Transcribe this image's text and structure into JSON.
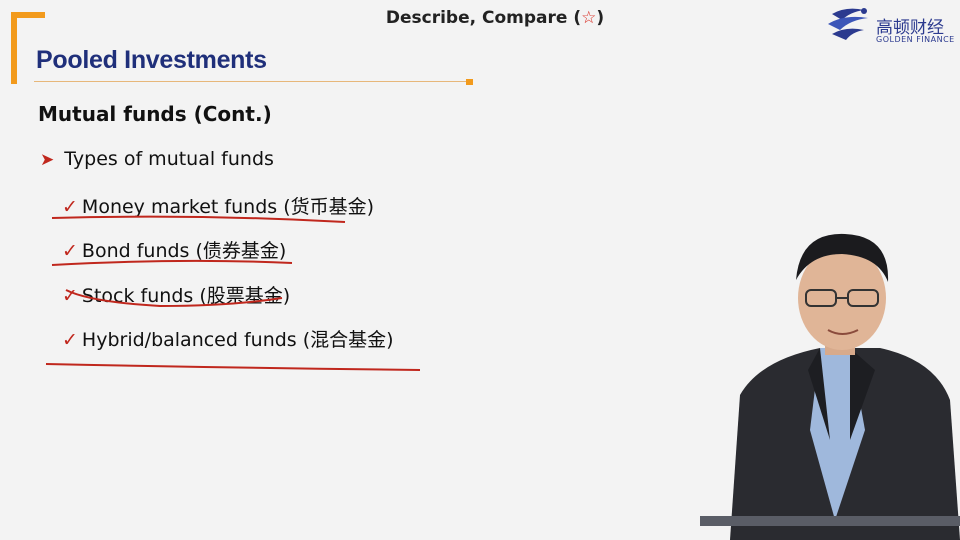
{
  "header": {
    "title_prefix": "Describe, Compare (",
    "title_star": "☆",
    "title_suffix": ")"
  },
  "section_title": "Pooled Investments",
  "logo": {
    "icon": "golden-finance-logo-icon",
    "name_cn": "高顿财经",
    "name_en": "GOLDEN FINANCE"
  },
  "content": {
    "subheading": "Mutual funds (Cont.)",
    "bullet": "Types of mutual funds",
    "items": [
      {
        "label": "Money market funds (货币基金)"
      },
      {
        "label": "Bond funds (债券基金)"
      },
      {
        "label": "Stock funds (股票基金)"
      },
      {
        "label": "Hybrid/balanced funds (混合基金)"
      }
    ]
  },
  "colors": {
    "accent_orange": "#f29a1c",
    "title_navy": "#1f2f7a",
    "mark_red": "#c0271d",
    "background": "#f3f3f3"
  }
}
